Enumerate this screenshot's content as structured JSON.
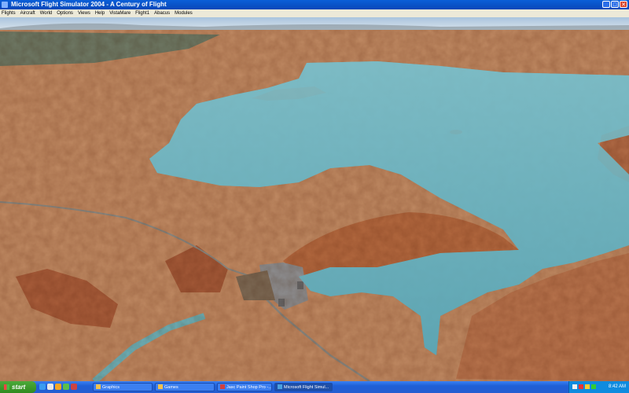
{
  "window": {
    "title": "Microsoft Flight Simulator 2004 - A Century of Flight"
  },
  "menu": [
    "Flights",
    "Aircraft",
    "World",
    "Options",
    "Views",
    "Help",
    "VistaMare",
    "Flight1",
    "Abacus",
    "Modules"
  ],
  "taskbar": {
    "start_label": "start",
    "tasks": [
      {
        "label": "Graphics",
        "icon_color": "#f2c14e"
      },
      {
        "label": "Games",
        "icon_color": "#f2c14e"
      },
      {
        "label": "Jasc Paint Shop Pro -...",
        "icon_color": "#d04040"
      },
      {
        "label": "Microsoft Flight Simul...",
        "icon_color": "#4aa0e0"
      }
    ],
    "clock": "8:42 AM"
  },
  "colors": {
    "water": "#6fb3bd",
    "terrain": "#c08a63",
    "sky": "#cfe0f0"
  }
}
